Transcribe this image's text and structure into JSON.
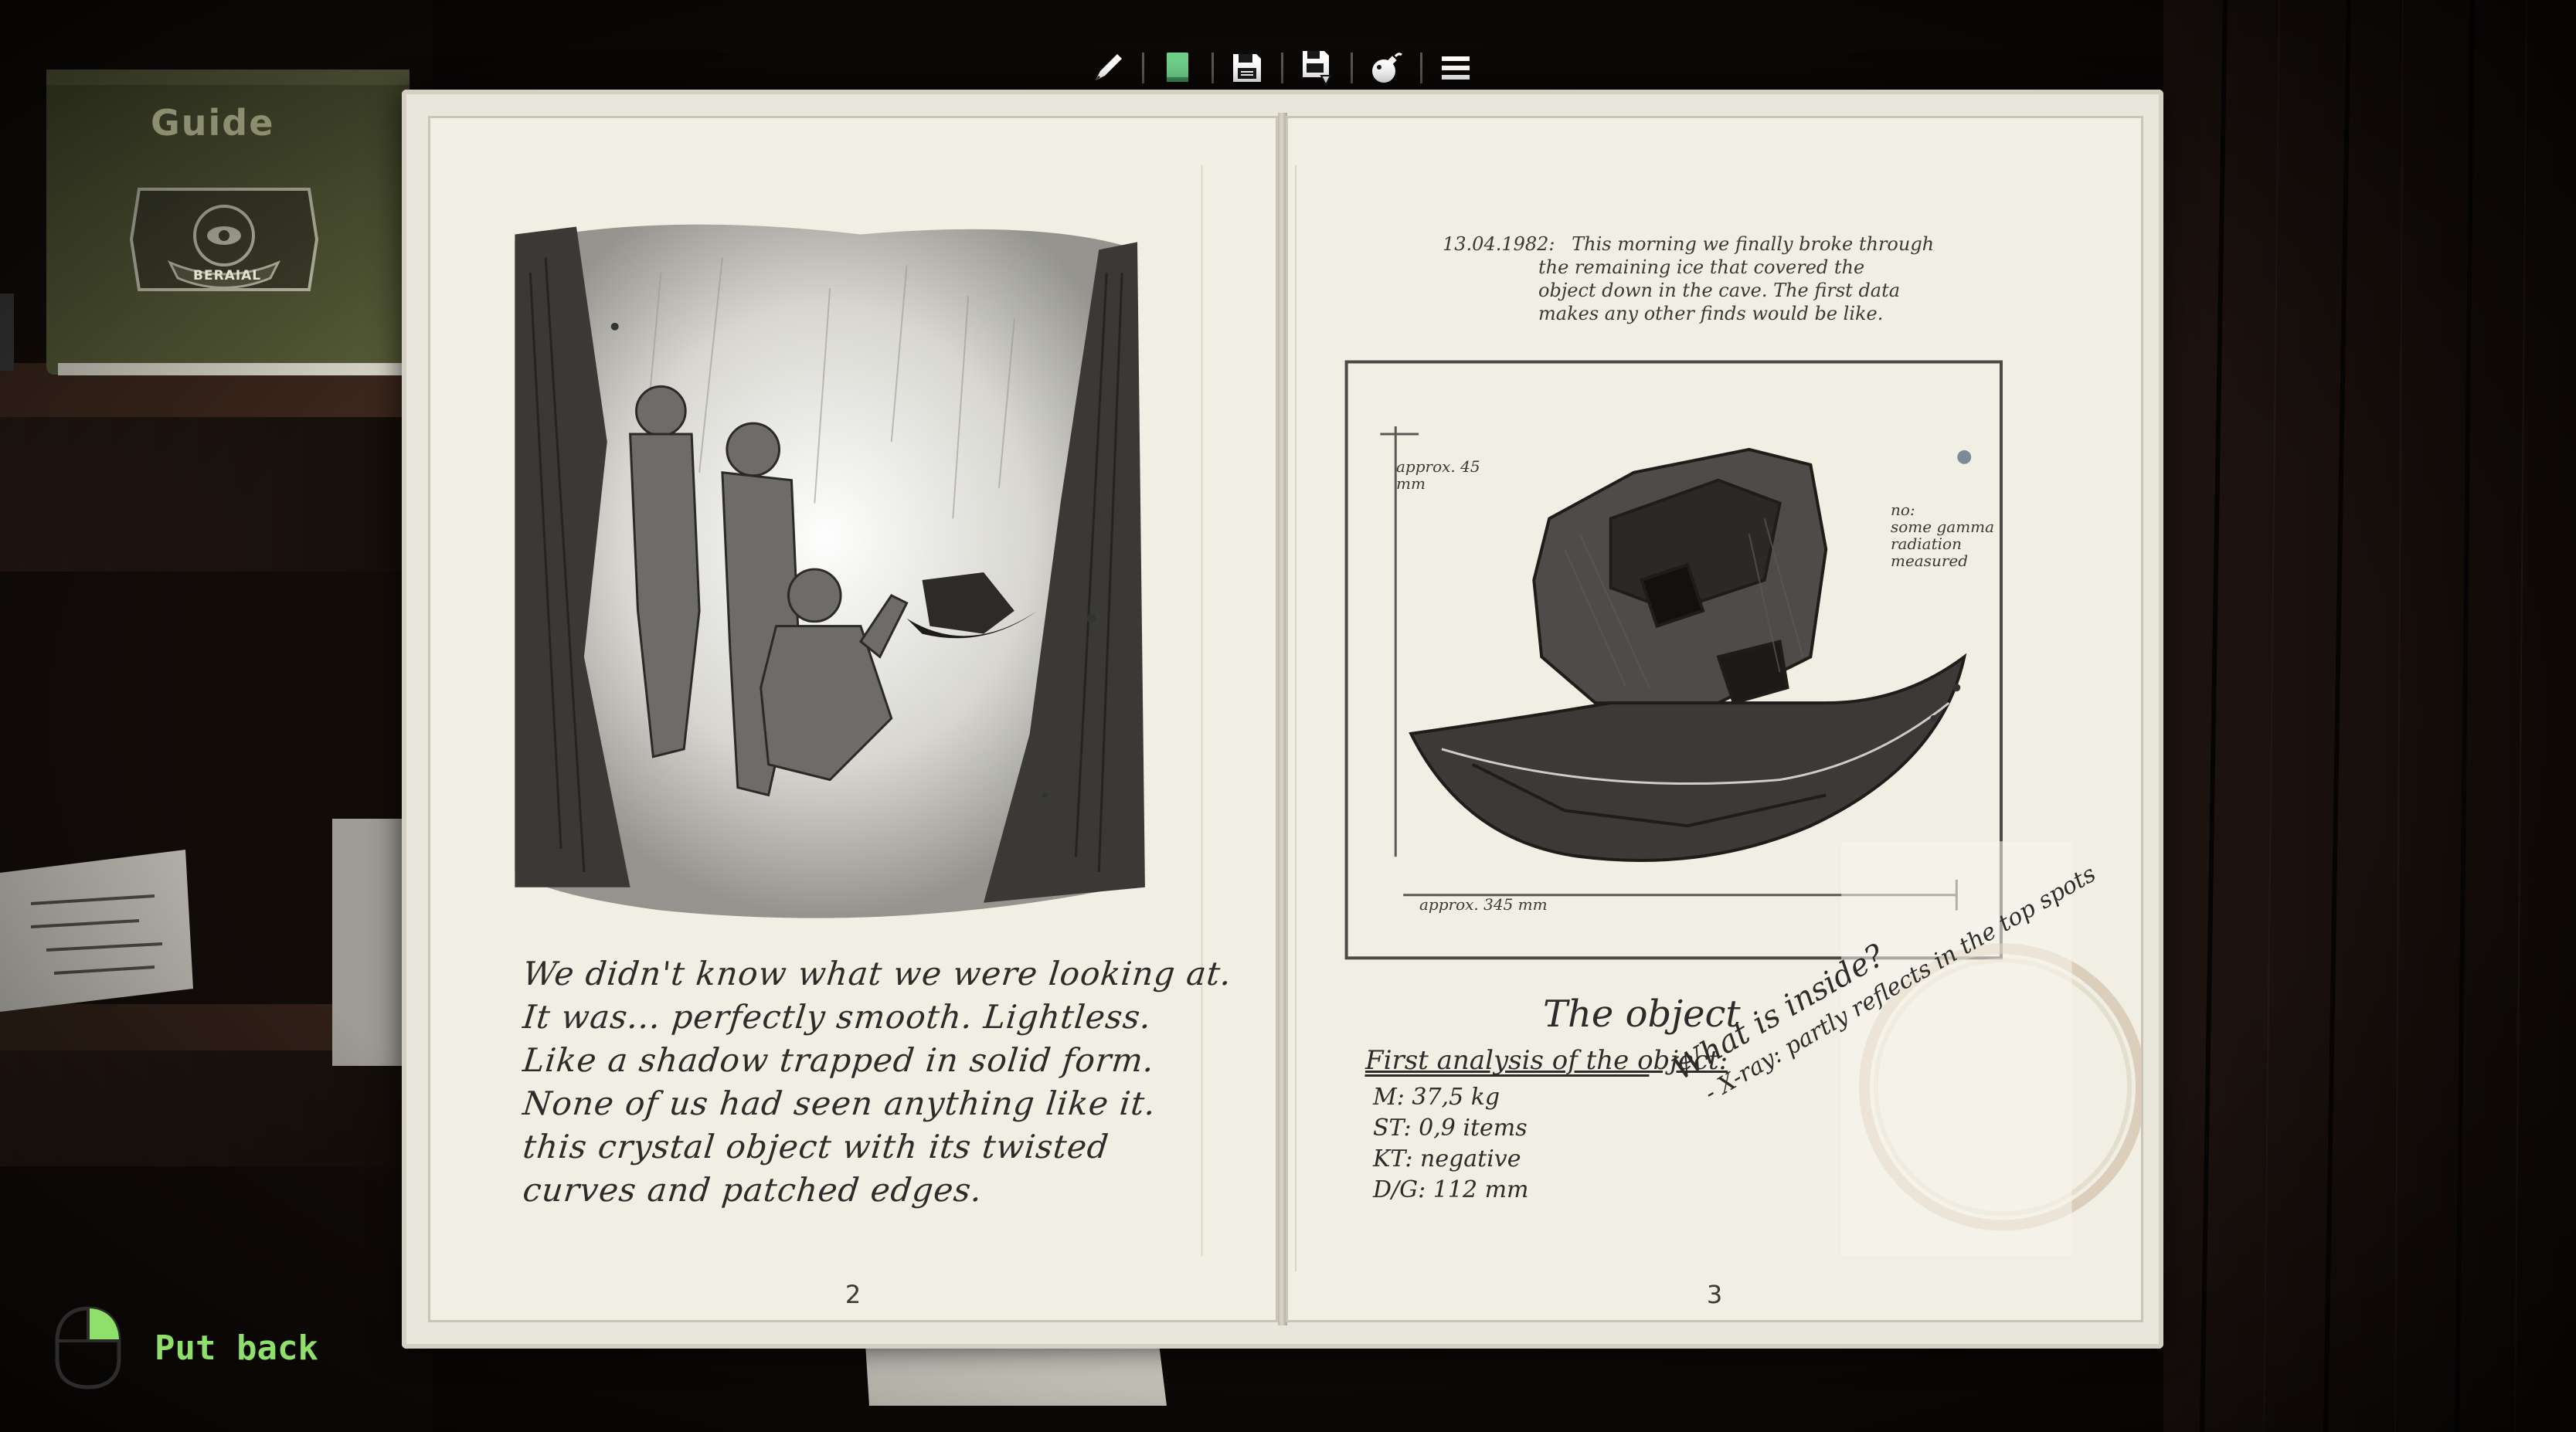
{
  "toolbar": {
    "items": [
      {
        "name": "Pen tool",
        "icon": "pen-icon"
      },
      {
        "name": "Notebook",
        "icon": "notebook-icon",
        "color": "#6fd08a"
      },
      {
        "name": "Save",
        "icon": "save-icon"
      },
      {
        "name": "Load",
        "icon": "load-icon"
      },
      {
        "name": "Hint",
        "icon": "bomb-icon"
      },
      {
        "name": "Menu",
        "icon": "hamburger-menu-icon"
      }
    ]
  },
  "background": {
    "guide_book_title": "Guide",
    "guide_book_emblem": "BERAIAL"
  },
  "notebook": {
    "left_page": {
      "number": "2",
      "text_lines": [
        "We didn't know what we were looking at.",
        "It was... perfectly smooth. Lightless.",
        "Like a shadow trapped in solid form.",
        "None of us had seen anything like it.",
        "this crystal object with its twisted",
        "curves and patched edges."
      ]
    },
    "right_page": {
      "number": "3",
      "entry_date": "13.04.1982:",
      "entry_lines": [
        "This morning we finally broke through",
        "the remaining ice that covered the",
        "object down in the cave. The first data",
        "makes any other finds would be like."
      ],
      "figure_label_height": "approx. 45 mm",
      "figure_label_width": "approx. 345 mm",
      "figure_note": [
        "no:",
        "some gamma",
        "radiation",
        "measured"
      ],
      "caption": "The object",
      "analysis_title": "First analysis of the object:",
      "analysis_lines": [
        "M: 37,5 kg",
        "ST: 0,9 items",
        "KT: negative",
        "D/G: 112 mm"
      ],
      "question_lines": [
        "What is inside?",
        "- X-ray: partly reflects in the top spots"
      ]
    }
  },
  "controls": {
    "put_back_label": "Put back",
    "accent_color": "#8fe06a"
  }
}
